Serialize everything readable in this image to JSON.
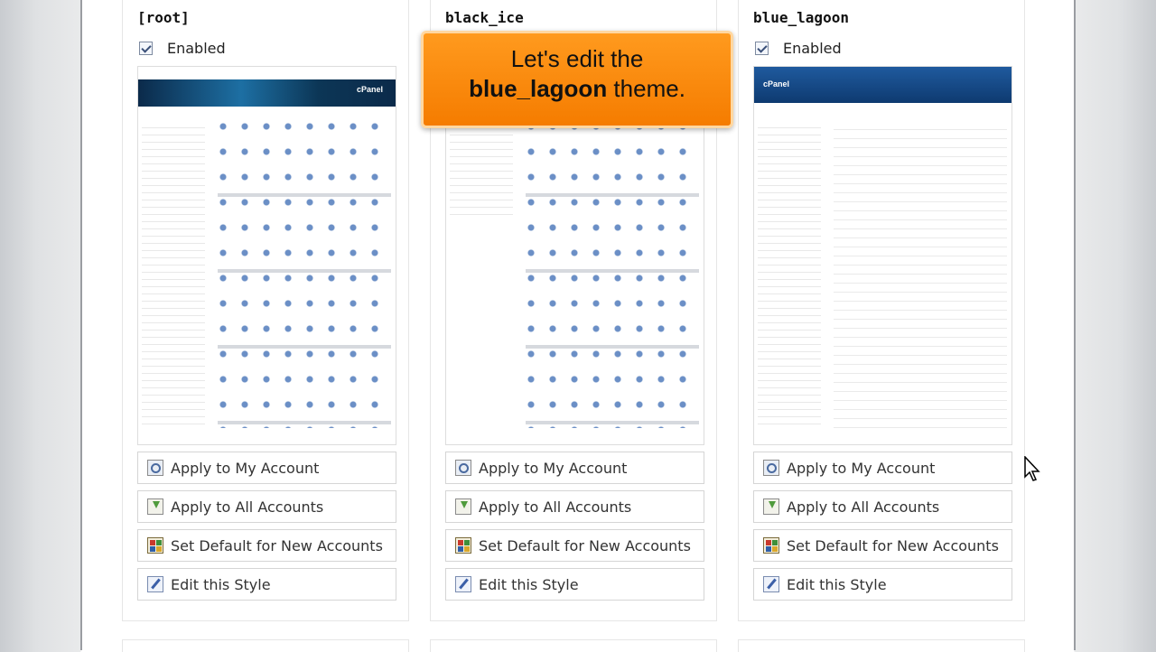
{
  "themes": [
    {
      "name": "[root]",
      "enabled_label": "Enabled",
      "enabled": true,
      "preview_logo": "cPanel",
      "buttons": {
        "apply_my": "Apply to My Account",
        "apply_all": "Apply to All Accounts",
        "set_default": "Set Default for New Accounts",
        "edit_style": "Edit this Style"
      }
    },
    {
      "name": "black_ice",
      "buttons": {
        "apply_my": "Apply to My Account",
        "apply_all": "Apply to All Accounts",
        "set_default": "Set Default for New Accounts",
        "edit_style": "Edit this Style"
      }
    },
    {
      "name": "blue_lagoon",
      "enabled_label": "Enabled",
      "enabled": true,
      "preview_logo": "cPanel",
      "buttons": {
        "apply_my": "Apply to My Account",
        "apply_all": "Apply to All Accounts",
        "set_default": "Set Default for New Accounts",
        "edit_style": "Edit this Style"
      }
    }
  ],
  "tooltip": {
    "line1": "Let's edit the",
    "bold": "blue_lagoon",
    "rest": " theme."
  },
  "icons": {
    "apply_my": "magnifier-icon",
    "apply_all": "download-icon",
    "set_default": "grid-icon",
    "edit_style": "pencil-icon"
  },
  "colors": {
    "tooltip_bg": "#f57c00",
    "root_banner": "#1d6fa3",
    "blue_lagoon_banner": "#0e3a70"
  }
}
